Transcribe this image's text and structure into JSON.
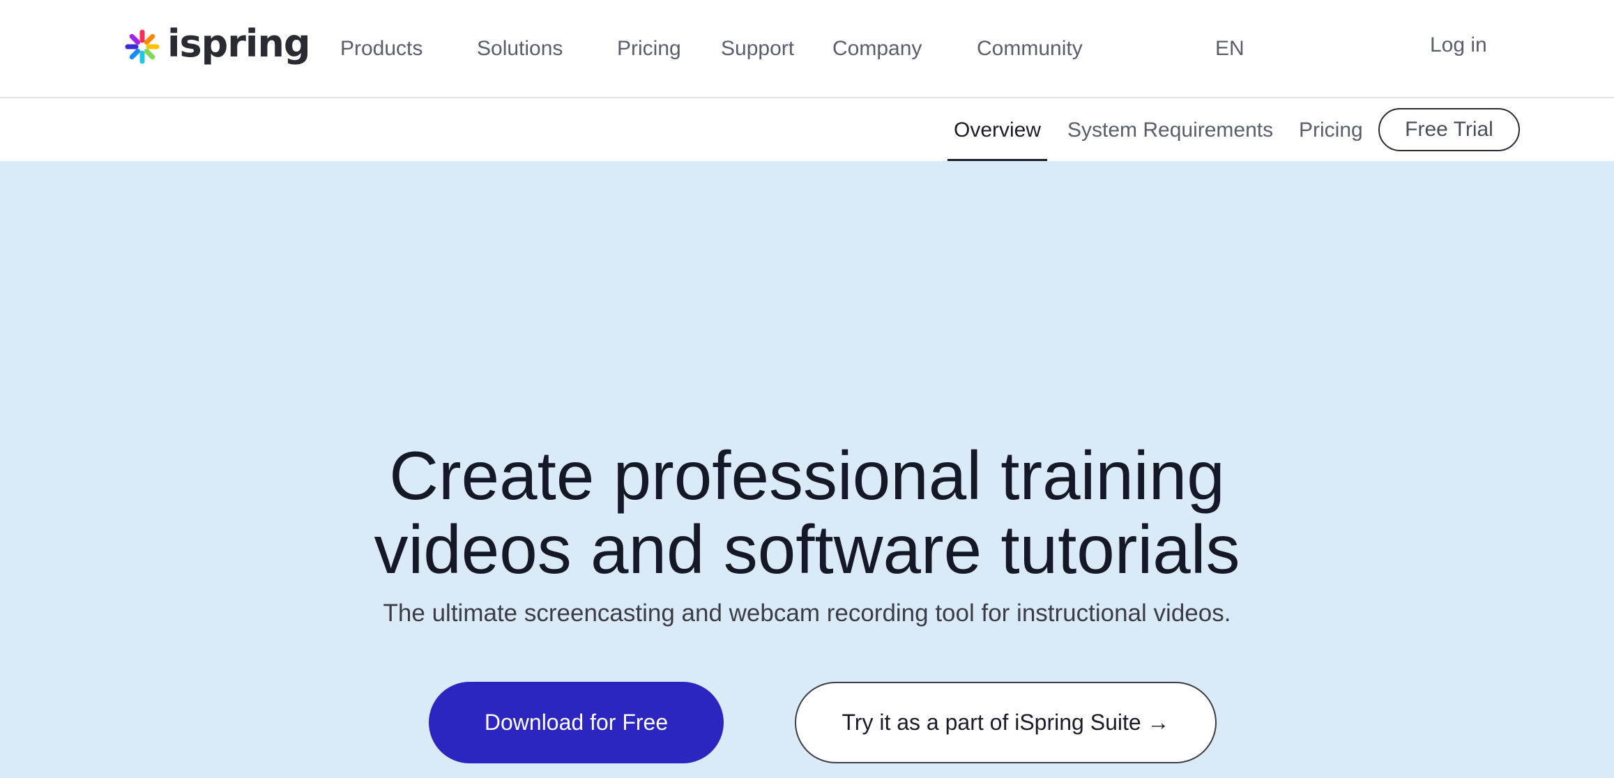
{
  "header": {
    "logo_text": "ispring",
    "nav": [
      {
        "label": "Products"
      },
      {
        "label": "Solutions"
      },
      {
        "label": "Pricing"
      },
      {
        "label": "Support"
      },
      {
        "label": "Company"
      },
      {
        "label": "Community"
      }
    ],
    "language": "EN",
    "login_label": "Log in"
  },
  "subnav": {
    "items": [
      {
        "label": "Overview",
        "active": true
      },
      {
        "label": "System Requirements",
        "active": false
      },
      {
        "label": "Pricing",
        "active": false
      }
    ],
    "cta_label": "Free Trial"
  },
  "hero": {
    "title_line1": "Create professional training",
    "title_line2": "videos and software tutorials",
    "subtitle": "The ultimate screencasting and webcam recording tool for instructional videos.",
    "primary_button": "Download for Free",
    "secondary_button": "Try it as a part of iSpring Suite →"
  },
  "colors": {
    "hero_background": "#daeaf6",
    "primary_button": "#2c25c0",
    "text_dark": "#151826",
    "nav_text": "#5a5d6b"
  },
  "icons": {
    "logo": "ispring-flower-icon"
  }
}
